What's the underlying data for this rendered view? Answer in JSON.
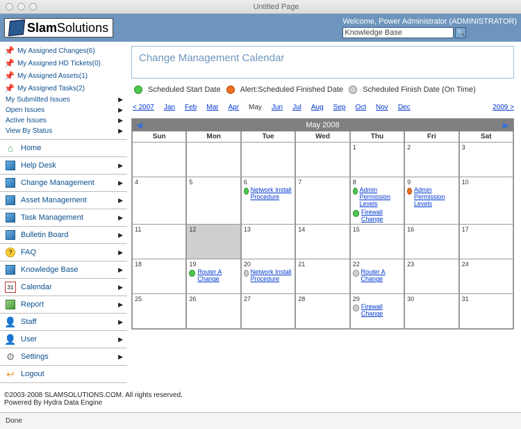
{
  "window": {
    "title": "Untitled Page"
  },
  "brand": {
    "name_bold": "Slam",
    "name_rest": "Solutions"
  },
  "topbar": {
    "welcome": "Welcome, Power Administrator (ADMINISTRATOR)",
    "search_value": "Knowledge Base"
  },
  "quicklinks": [
    {
      "label": "My Assigned Changes(6)"
    },
    {
      "label": "My Assigned HD Tickets(0)"
    },
    {
      "label": "My Assigned Assets(1)"
    },
    {
      "label": "My Assigned Tasks(2)"
    }
  ],
  "minilinks": [
    {
      "label": "My Submitted Issues"
    },
    {
      "label": "Open Issues"
    },
    {
      "label": "Active Issues"
    },
    {
      "label": "View By Status"
    }
  ],
  "nav": [
    {
      "label": "Home",
      "icon": "home",
      "expand": false
    },
    {
      "label": "Help Desk",
      "icon": "cube",
      "expand": true
    },
    {
      "label": "Change Management",
      "icon": "cube",
      "expand": true
    },
    {
      "label": "Asset Management",
      "icon": "cube",
      "expand": true
    },
    {
      "label": "Task Management",
      "icon": "cube",
      "expand": true
    },
    {
      "label": "Bulletin Board",
      "icon": "cube",
      "expand": true
    },
    {
      "label": "FAQ",
      "icon": "faq",
      "expand": true
    },
    {
      "label": "Knowledge Base",
      "icon": "cube",
      "expand": true
    },
    {
      "label": "Calendar",
      "icon": "cal",
      "expand": true
    },
    {
      "label": "Report",
      "icon": "report",
      "expand": true
    },
    {
      "label": "Staff",
      "icon": "person",
      "expand": true
    },
    {
      "label": "User",
      "icon": "person",
      "expand": true
    },
    {
      "label": "Settings",
      "icon": "gear",
      "expand": true
    },
    {
      "label": "Logout",
      "icon": "logout",
      "expand": false
    }
  ],
  "panel": {
    "title": "Change Management Calendar"
  },
  "legend": {
    "start": "Scheduled Start Date",
    "alert": "Alert:Scheduled Finished Date",
    "finish": "Scheduled Finish Date (On Time)"
  },
  "monthnav": {
    "prev_year": "< 2007",
    "months": [
      "Jan",
      "Feb",
      "Mar",
      "Apr",
      "May",
      "Jun",
      "Jul",
      "Aug",
      "Sep",
      "Oct",
      "Nov",
      "Dec"
    ],
    "current_index": 4,
    "next_year": "2009 >"
  },
  "calendar": {
    "title": "May 2008",
    "dow": [
      "Sun",
      "Mon",
      "Tue",
      "Wed",
      "Thu",
      "Fri",
      "Sat"
    ],
    "today": 12,
    "weeks": [
      [
        {
          "d": ""
        },
        {
          "d": ""
        },
        {
          "d": ""
        },
        {
          "d": ""
        },
        {
          "d": "1"
        },
        {
          "d": "2"
        },
        {
          "d": "3"
        }
      ],
      [
        {
          "d": "4"
        },
        {
          "d": "5"
        },
        {
          "d": "6",
          "events": [
            {
              "c": "green",
              "t": "Network Install Procedure"
            }
          ]
        },
        {
          "d": "7"
        },
        {
          "d": "8",
          "events": [
            {
              "c": "green",
              "t": "Admin Permission Levels"
            },
            {
              "c": "green",
              "t": "Firewall Change"
            }
          ]
        },
        {
          "d": "9",
          "events": [
            {
              "c": "orange",
              "t": "Admin Permission Levels"
            }
          ]
        },
        {
          "d": "10"
        }
      ],
      [
        {
          "d": "11"
        },
        {
          "d": "12"
        },
        {
          "d": "13"
        },
        {
          "d": "14"
        },
        {
          "d": "15"
        },
        {
          "d": "16"
        },
        {
          "d": "17"
        }
      ],
      [
        {
          "d": "18"
        },
        {
          "d": "19",
          "events": [
            {
              "c": "green",
              "t": "Router A Change"
            }
          ]
        },
        {
          "d": "20",
          "events": [
            {
              "c": "gray",
              "t": "Network Install Procedure"
            }
          ]
        },
        {
          "d": "21"
        },
        {
          "d": "22",
          "events": [
            {
              "c": "gray",
              "t": "Router A Change"
            }
          ]
        },
        {
          "d": "23"
        },
        {
          "d": "24"
        }
      ],
      [
        {
          "d": "25"
        },
        {
          "d": "26"
        },
        {
          "d": "27"
        },
        {
          "d": "28"
        },
        {
          "d": "29",
          "events": [
            {
              "c": "gray",
              "t": "Firewall Change"
            }
          ]
        },
        {
          "d": "30"
        },
        {
          "d": "31"
        }
      ]
    ]
  },
  "footer": {
    "copyright": "©2003-2008 SLAMSOLUTIONS.COM. All rights reserved.",
    "engine": "Powered By Hydra Data Engine"
  },
  "status": {
    "text": "Done"
  },
  "icons": {
    "cal_num": "31"
  }
}
